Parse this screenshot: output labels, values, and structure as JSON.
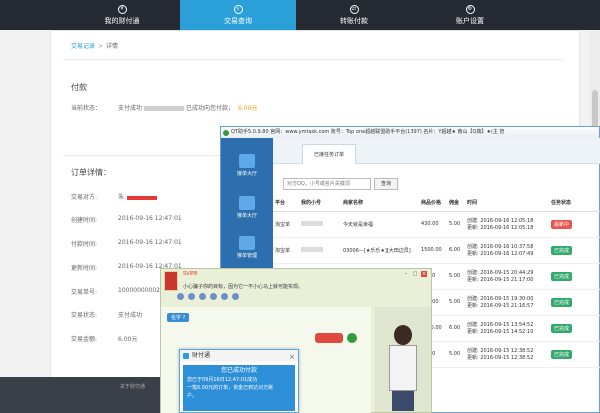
{
  "nav": {
    "tabs": [
      {
        "label": "我的财付通",
        "icon": "wallet-icon"
      },
      {
        "label": "交易查询",
        "icon": "search-icon",
        "active": true
      },
      {
        "label": "转账付款",
        "icon": "transfer-icon"
      },
      {
        "label": "账户设置",
        "icon": "gear-icon"
      }
    ]
  },
  "breadcrumb": {
    "root": "交易记录",
    "sep": ">",
    "current": "详情"
  },
  "payment": {
    "title": "付款",
    "status_key": "当前状态：",
    "status_prefix": "支付成功",
    "status_suffix": "已成功向您付款，",
    "amount": "6.00元"
  },
  "order": {
    "title": "订单详情：",
    "fields": [
      {
        "k": "交易对方:",
        "v": "朱"
      },
      {
        "k": "创建时间:",
        "v": "2016-09-16 12:47:01"
      },
      {
        "k": "付款时间:",
        "v": "2016-09-16 12:47:01"
      },
      {
        "k": "更新时间:",
        "v": "2016-09-16 12:47:01"
      },
      {
        "k": "交易单号:",
        "v": "100000000020"
      },
      {
        "k": "交易状态:",
        "v": "支付成功"
      },
      {
        "k": "交易金额:",
        "v": "6.00元"
      }
    ]
  },
  "footer": {
    "text": "关于财付通"
  },
  "qt": {
    "title": "QT助手5.0.9.80 官网：www.ymtask.com 账号：Top one超越联盟助手平台(1397) 名片：Y超越★ 南山【Q端】★(主 管",
    "side": [
      {
        "label": "接单大厅"
      },
      {
        "label": "接单大厅"
      },
      {
        "label": "接单管理"
      }
    ],
    "tab": "已接任务订单",
    "search": {
      "placeholder": "对方QQ，小号或名片关键词",
      "button": "查询"
    },
    "table": {
      "headers": [
        "平台",
        "我的小号",
        "商家名称",
        "商品价格",
        "佣金",
        "时间",
        "任务状态"
      ],
      "rows": [
        {
          "platform": "淘宝单",
          "merchant": "今天就是幸福",
          "price": "430.00",
          "commission": "5.00",
          "created": "创建: 2016-09-16 12:05:18",
          "updated": "更新: 2016-09-16 12:05:18",
          "status": "最新中",
          "status_type": "pend"
        },
        {
          "platform": "淘宝单",
          "merchant": "03006—[★乐乐★][大田边员]",
          "price": "1500.00",
          "commission": "6.00",
          "created": "创建: 2016-09-16 10:37:58",
          "updated": "更新: 2016-09-16 12:07:49",
          "status": "已完成",
          "status_type": "done"
        },
        {
          "platform": "",
          "merchant": "",
          "price": "89.00",
          "commission": "5.00",
          "created": "创建: 2016-09-15 20:44:29",
          "updated": "更新: 2016-09-15 21:17:00",
          "status": "已完成",
          "status_type": "done"
        },
        {
          "platform": "",
          "merchant": "",
          "price": "168.00",
          "commission": "5.00",
          "created": "创建: 2016-09-15 19:30:00",
          "updated": "更新: 2016-09-15 21:16:57",
          "status": "已完成",
          "status_type": "done"
        },
        {
          "platform": "",
          "merchant": "",
          "price": "2680.00",
          "commission": "6.00",
          "created": "创建: 2016-09-15 13:54:52",
          "updated": "更新: 2016-09-15 14:52:10",
          "status": "已完成",
          "status_type": "done"
        },
        {
          "platform": "",
          "merchant": "",
          "price": "70.00",
          "commission": "5.00",
          "created": "创建: 2016-09-15 12:38:52",
          "updated": "更新: 2016-09-15 12:38:52",
          "status": "已完成",
          "status_type": "done"
        }
      ]
    }
  },
  "chat": {
    "name": "SVIP8",
    "message": "小心骗子你的目标，因为它一不小心马上就可能实现。",
    "bubble": "名字 ?"
  },
  "notice": {
    "title": "财付通",
    "heading": "您已成功付款",
    "line1": "您已于09月16日12:47:01成功",
    "line2": "一笔6.00元的订单，资金已到达对方账",
    "line3": "户。"
  }
}
